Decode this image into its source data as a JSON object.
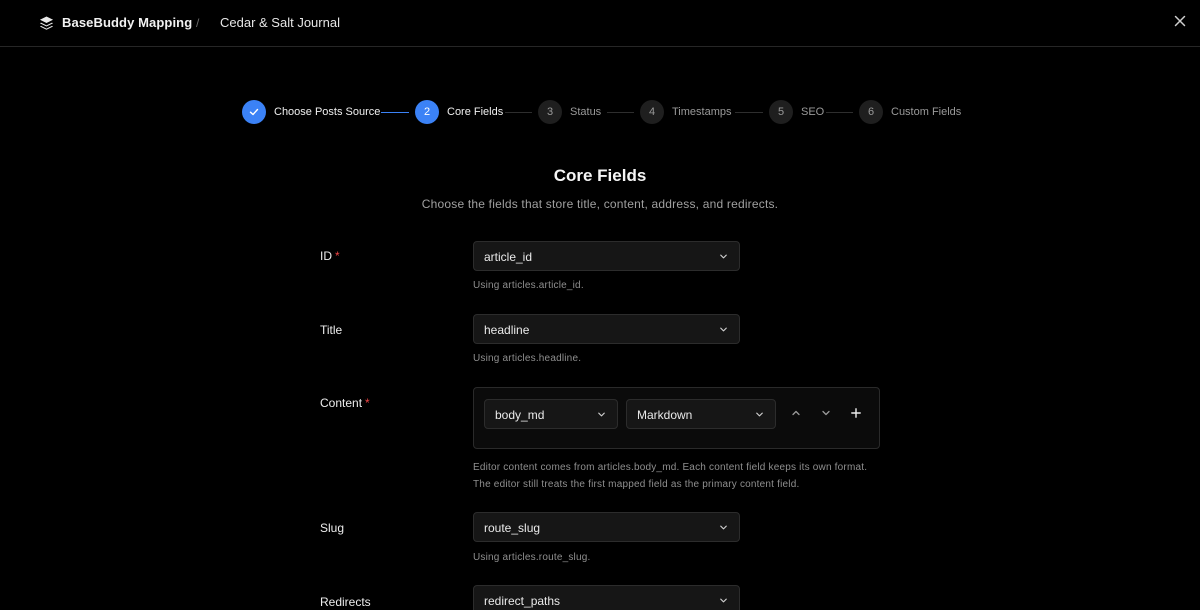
{
  "header": {
    "app_title": "BaseBuddy Mapping",
    "separator": "/",
    "project_name": "Cedar & Salt Journal"
  },
  "stepper": {
    "steps": [
      {
        "number": "1",
        "label": "Choose Posts Source",
        "state": "done"
      },
      {
        "number": "2",
        "label": "Core Fields",
        "state": "active"
      },
      {
        "number": "3",
        "label": "Status",
        "state": "todo"
      },
      {
        "number": "4",
        "label": "Timestamps",
        "state": "todo"
      },
      {
        "number": "5",
        "label": "SEO",
        "state": "todo"
      },
      {
        "number": "6",
        "label": "Custom Fields",
        "state": "todo"
      }
    ]
  },
  "page": {
    "title": "Core Fields",
    "subtitle": "Choose the fields that store title, content, address, and redirects."
  },
  "fields": {
    "id": {
      "label": "ID",
      "required": "*",
      "value": "article_id",
      "help": "Using articles.article_id."
    },
    "title": {
      "label": "Title",
      "value": "headline",
      "help": "Using articles.headline."
    },
    "content": {
      "label": "Content",
      "required": "*",
      "field_value": "body_md",
      "format_value": "Markdown",
      "help_line1": "Editor content comes from articles.body_md. Each content field keeps its own format.",
      "help_line2": "The editor still treats the first mapped field as the primary content field."
    },
    "slug": {
      "label": "Slug",
      "value": "route_slug",
      "help": "Using articles.route_slug."
    },
    "redirects": {
      "label": "Redirects",
      "value": "redirect_paths"
    }
  },
  "colors": {
    "accent": "#3b82f6",
    "required": "#ef4444",
    "background": "#000000"
  },
  "icons": {
    "logo": "layers-icon",
    "close": "close-icon",
    "chevron": "chevron-down-icon",
    "check": "check-icon",
    "move_up": "chevron-up-icon",
    "move_down": "chevron-down-icon",
    "add": "plus-icon"
  }
}
